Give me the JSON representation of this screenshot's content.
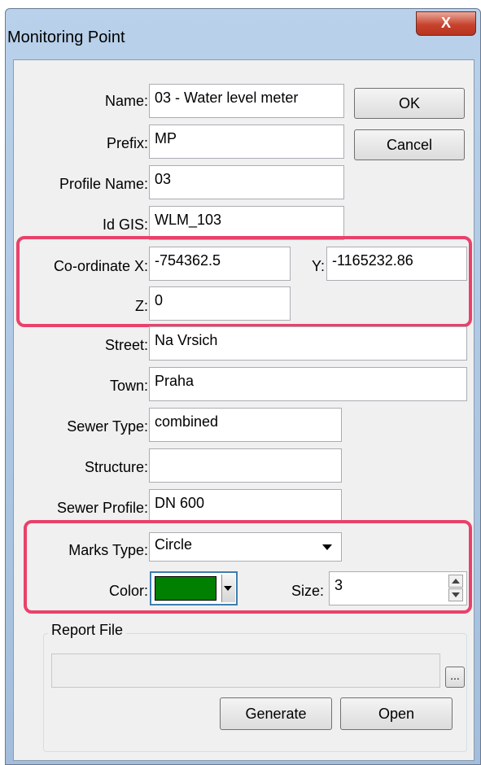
{
  "window": {
    "title": "Monitoring Point",
    "close_glyph": "X"
  },
  "buttons": {
    "ok": "OK",
    "cancel": "Cancel"
  },
  "fields": {
    "name": {
      "label": "Name:",
      "value": "03 - Water level meter"
    },
    "prefix": {
      "label": "Prefix:",
      "value": "MP"
    },
    "profile_name": {
      "label": "Profile Name:",
      "value": "03"
    },
    "id_gis": {
      "label": "Id GIS:",
      "value": "WLM_103"
    },
    "coord_x": {
      "label": "Co-ordinate X:",
      "value": "-754362.5"
    },
    "coord_y": {
      "label": "Y:",
      "value": "-1165232.86"
    },
    "coord_z": {
      "label": "Z:",
      "value": "0"
    },
    "street": {
      "label": "Street:",
      "value": "Na Vrsich"
    },
    "town": {
      "label": "Town:",
      "value": "Praha"
    },
    "sewer_type": {
      "label": "Sewer Type:",
      "value": "combined"
    },
    "structure": {
      "label": "Structure:",
      "value": ""
    },
    "sewer_profile": {
      "label": "Sewer Profile:",
      "value": "DN 600"
    }
  },
  "marks": {
    "type_label": "Marks Type:",
    "type_value": "Circle",
    "color_label": "Color:",
    "color_value": "#008000",
    "size_label": "Size:",
    "size_value": "3"
  },
  "report": {
    "group_title": "Report File",
    "path_value": "",
    "browse_label": "...",
    "generate_label": "Generate",
    "open_label": "Open"
  },
  "colors": {
    "highlight": "#e9416b",
    "close_red": "#c7432e"
  }
}
